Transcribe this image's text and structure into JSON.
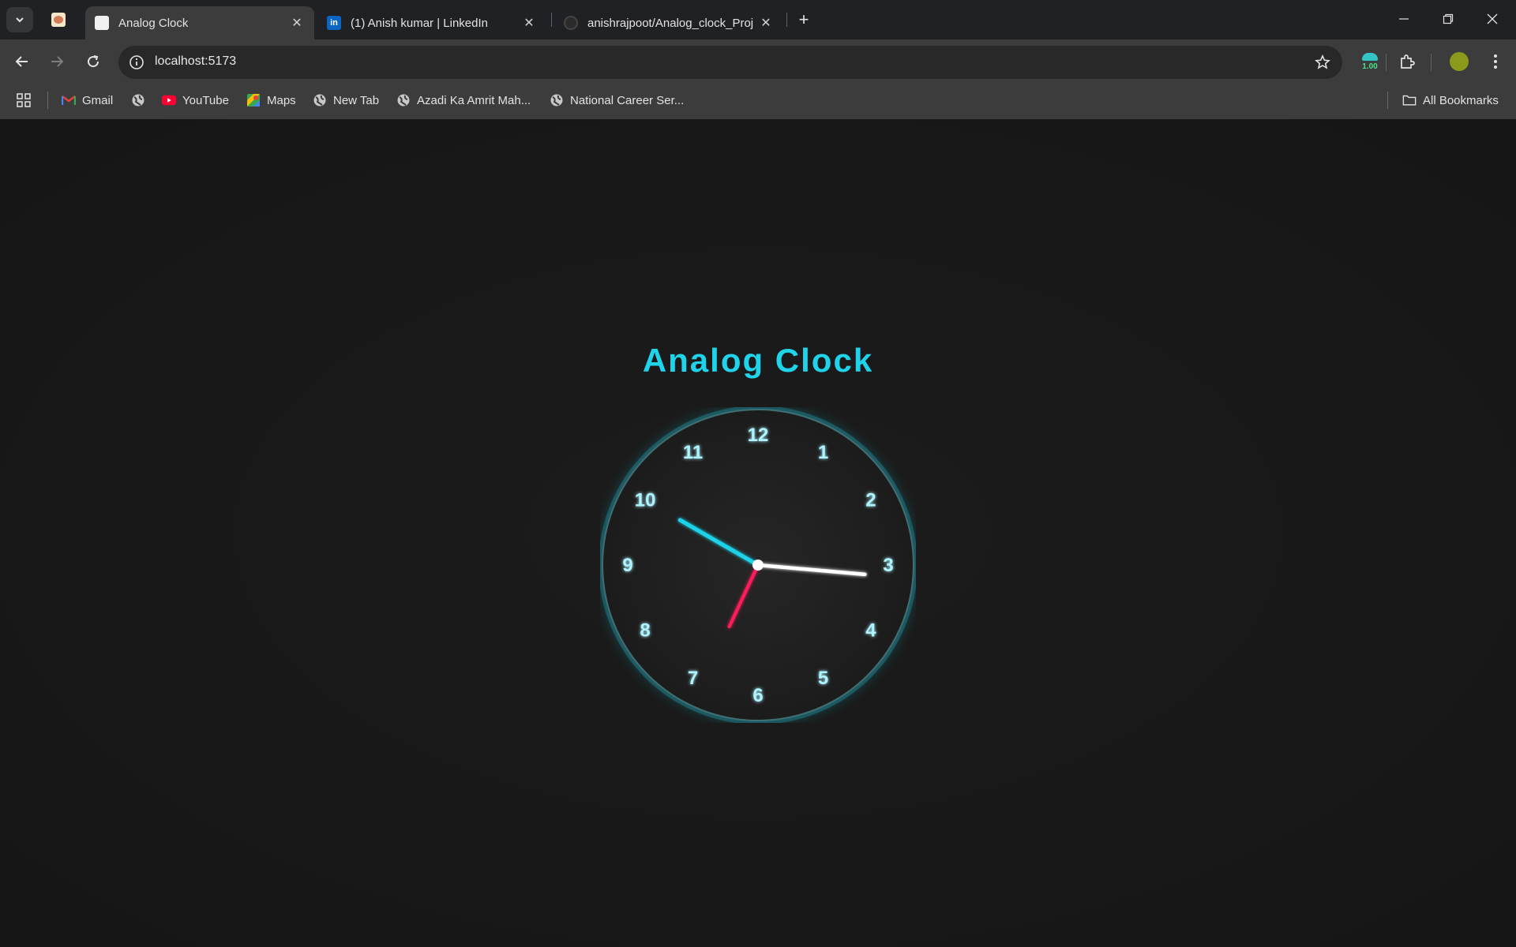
{
  "browser": {
    "tabs": [
      {
        "title": "Analog Clock",
        "active": true
      },
      {
        "title": "(1) Anish kumar | LinkedIn",
        "active": false
      },
      {
        "title": "anishrajpoot/Analog_clock_Proj",
        "active": false
      }
    ],
    "address": "localhost:5173",
    "extension_badge": "1.00",
    "bookmarks": [
      {
        "label": "Gmail",
        "icon": "gmail-icon"
      },
      {
        "label": "",
        "icon": "globe-icon"
      },
      {
        "label": "YouTube",
        "icon": "youtube-icon"
      },
      {
        "label": "Maps",
        "icon": "maps-icon"
      },
      {
        "label": "New Tab",
        "icon": "globe-icon"
      },
      {
        "label": "Azadi Ka Amrit Mah...",
        "icon": "globe-icon"
      },
      {
        "label": "National Career Ser...",
        "icon": "globe-icon"
      }
    ],
    "all_bookmarks": "All Bookmarks"
  },
  "page": {
    "title": "Analog Clock"
  },
  "clock": {
    "numbers": [
      "12",
      "1",
      "2",
      "3",
      "4",
      "5",
      "6",
      "7",
      "8",
      "9",
      "10",
      "11"
    ],
    "hour_hand_deg": 300,
    "minute_hand_deg": 95,
    "second_hand_deg": 205,
    "colors": {
      "accent": "#1fd3ea",
      "hour_hand": "#1fd3ea",
      "minute_hand": "#ffffff",
      "second_hand": "#ff1f5a",
      "numbers": "#aef4ff"
    }
  }
}
